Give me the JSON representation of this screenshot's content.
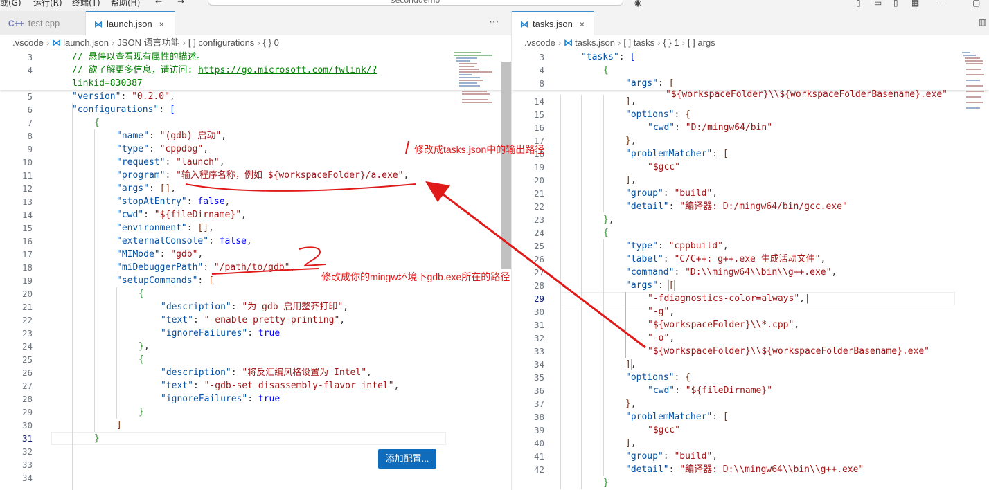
{
  "menubar": {
    "items": [
      "或(G)",
      "运行(R)",
      "终端(T)",
      "帮助(H)"
    ],
    "nav_back": "←",
    "nav_forward": "→",
    "command_center_text": "seconddemo"
  },
  "left_editor": {
    "tabs": [
      {
        "label": "test.cpp",
        "icon": "C++"
      },
      {
        "label": "launch.json",
        "icon": "⋈",
        "close": "×"
      }
    ],
    "more": "···",
    "breadcrumb": [
      ".vscode",
      "launch.json",
      "JSON 语言功能",
      "[ ] configurations",
      "{ } 0"
    ],
    "sticky_line_numbers": [
      "3",
      "4"
    ],
    "line_numbers": [
      "5",
      "6",
      "7",
      "8",
      "9",
      "10",
      "11",
      "12",
      "13",
      "14",
      "15",
      "16",
      "17",
      "18",
      "19",
      "20",
      "21",
      "22",
      "23",
      "24",
      "25",
      "26",
      "27",
      "28",
      "29",
      "30",
      "31",
      "32",
      "33",
      "34"
    ],
    "current_line": "31",
    "add_configuration_button": "添加配置..."
  },
  "right_editor": {
    "tabs": [
      {
        "label": "tasks.json",
        "icon": "⋈",
        "close": "×"
      }
    ],
    "breadcrumb": [
      ".vscode",
      "tasks.json",
      "[ ] tasks",
      "{ } 1",
      "[ ] args"
    ],
    "sticky_line_numbers": [
      "3",
      "4",
      "8"
    ],
    "line_numbers": [
      "14",
      "15",
      "16",
      "17",
      "18",
      "19",
      "20",
      "21",
      "22",
      "23",
      "24",
      "25",
      "26",
      "27",
      "28",
      "29",
      "30",
      "31",
      "32",
      "33",
      "34",
      "35",
      "36",
      "37",
      "38",
      "39",
      "40",
      "41",
      "42"
    ],
    "current_line": "29"
  },
  "annotations": {
    "note1_mark": "1",
    "note1_text": "修改成tasks.json中的输出路径",
    "note2_mark": "2",
    "note2_text": "修改成你的mingw环境下gdb.exe所在的路径"
  },
  "colors": {
    "accent": "#0f6cbd",
    "annotation": "#e01919",
    "json_key": "#0451a5",
    "json_string": "#a31515",
    "json_keyword": "#0000ff",
    "comment": "#008000"
  }
}
